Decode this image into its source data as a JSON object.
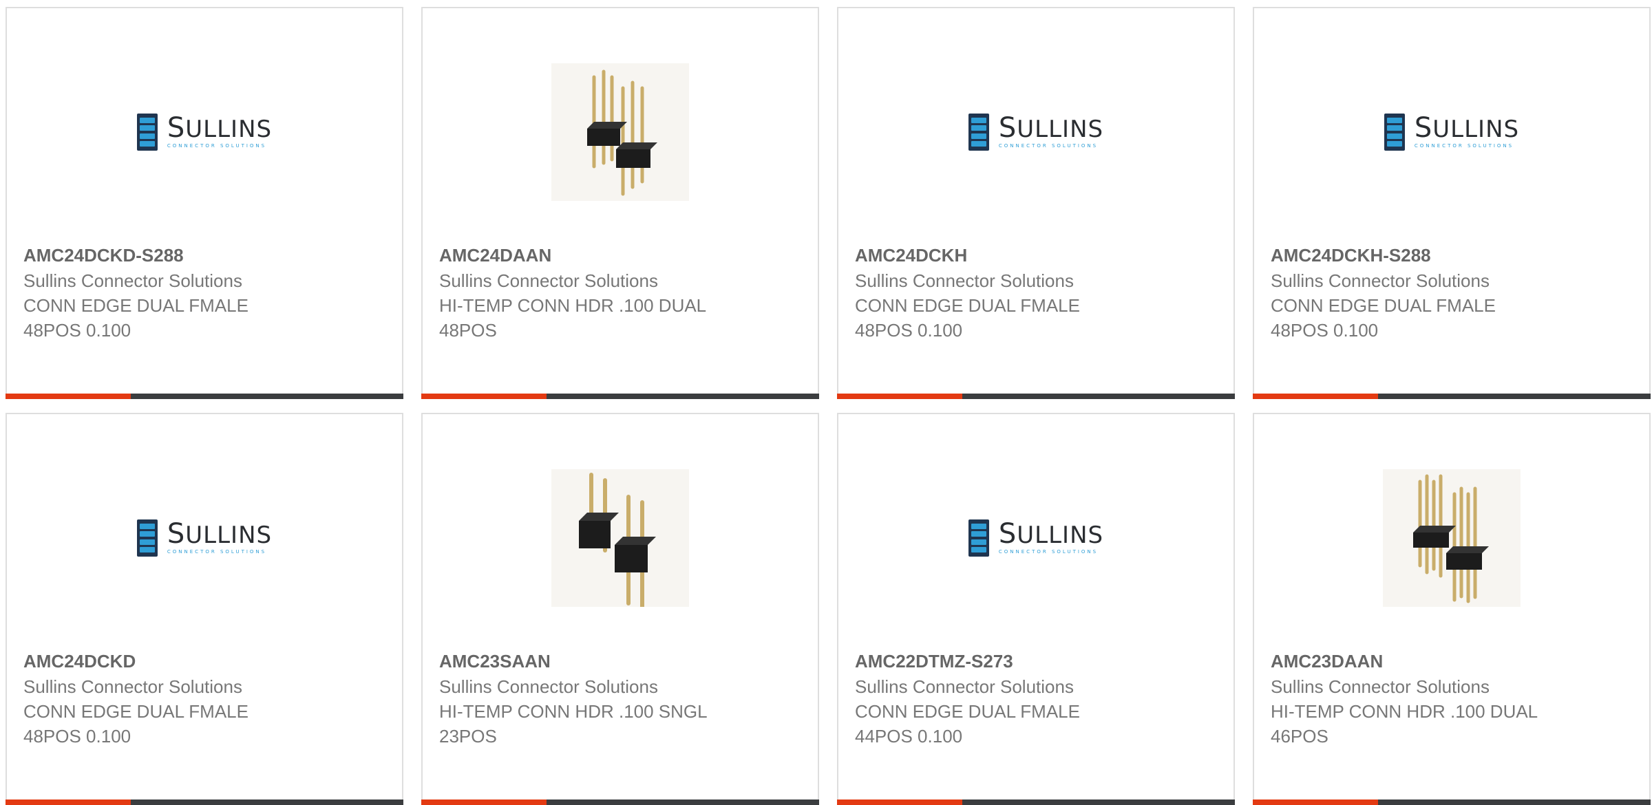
{
  "logo": {
    "word_first": "S",
    "word_rest": "ULLINS",
    "sub": "CONNECTOR SOLUTIONS"
  },
  "cards": [
    {
      "part": "AMC24DCKD-S288",
      "manufacturer": "Sullins Connector Solutions",
      "description": "CONN EDGE DUAL FMALE\n48POS 0.100",
      "image": "sullins-logo"
    },
    {
      "part": "AMC24DAAN",
      "manufacturer": "Sullins Connector Solutions",
      "description": "HI-TEMP CONN HDR .100 DUAL\n48POS",
      "image": "pin-header-photo"
    },
    {
      "part": "AMC24DCKH",
      "manufacturer": "Sullins Connector Solutions",
      "description": "CONN EDGE DUAL FMALE\n48POS 0.100",
      "image": "sullins-logo"
    },
    {
      "part": "AMC24DCKH-S288",
      "manufacturer": "Sullins Connector Solutions",
      "description": "CONN EDGE DUAL FMALE\n48POS 0.100",
      "image": "sullins-logo"
    },
    {
      "part": "AMC24DCKD",
      "manufacturer": "Sullins Connector Solutions",
      "description": "CONN EDGE DUAL FMALE\n48POS 0.100",
      "image": "sullins-logo"
    },
    {
      "part": "AMC23SAAN",
      "manufacturer": "Sullins Connector Solutions",
      "description": "HI-TEMP CONN HDR .100 SNGL\n23POS",
      "image": "pin-header-photo"
    },
    {
      "part": "AMC22DTMZ-S273",
      "manufacturer": "Sullins Connector Solutions",
      "description": "CONN EDGE DUAL FMALE\n44POS 0.100",
      "image": "sullins-logo"
    },
    {
      "part": "AMC23DAAN",
      "manufacturer": "Sullins Connector Solutions",
      "description": "HI-TEMP CONN HDR .100 DUAL\n46POS",
      "image": "pin-header-photo"
    }
  ],
  "colors": {
    "accent": "#e33a12",
    "bar": "#3b3d3f",
    "logo_blue": "#2f9ed6",
    "logo_dark": "#1f3550"
  }
}
